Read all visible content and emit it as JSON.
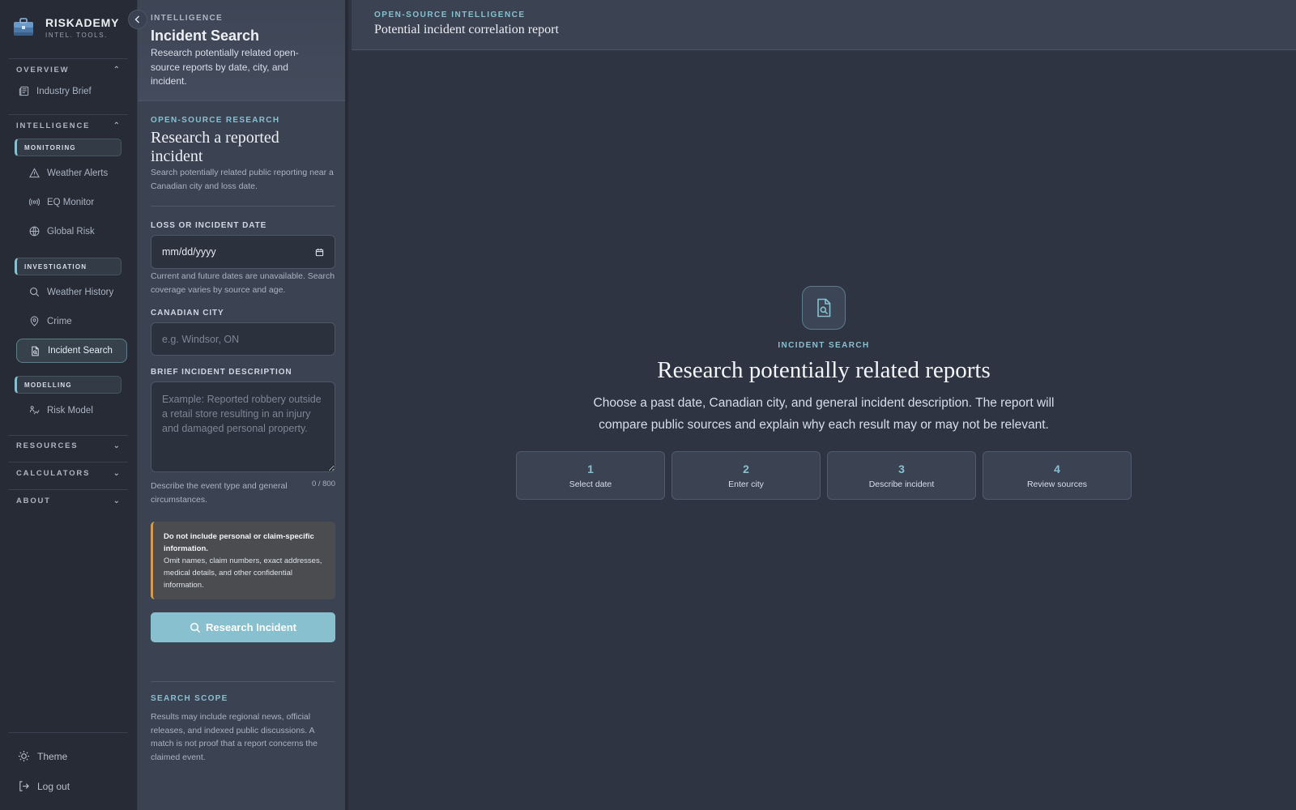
{
  "brand": {
    "name": "RISKADEMY",
    "tagline": "INTEL. TOOLS."
  },
  "sidebar": {
    "overview": {
      "label": "OVERVIEW",
      "chevron": "⌃",
      "items": [
        {
          "label": "Industry Brief",
          "icon": "newspaper-icon"
        }
      ]
    },
    "intelligence": {
      "label": "INTELLIGENCE",
      "chevron": "⌃",
      "monitoring": {
        "label": "MONITORING",
        "items": [
          {
            "label": "Weather Alerts",
            "icon": "warning-triangle-icon"
          },
          {
            "label": "EQ Monitor",
            "icon": "radar-icon"
          },
          {
            "label": "Global Risk",
            "icon": "globe-icon"
          }
        ]
      },
      "investigation": {
        "label": "INVESTIGATION",
        "items": [
          {
            "label": "Weather History",
            "icon": "search-icon"
          },
          {
            "label": "Crime",
            "icon": "map-pin-icon"
          },
          {
            "label": "Incident Search",
            "icon": "file-search-icon",
            "active": true
          }
        ]
      },
      "modelling": {
        "label": "MODELLING",
        "items": [
          {
            "label": "Risk Model",
            "icon": "chart-person-icon"
          }
        ]
      }
    },
    "resources": {
      "label": "RESOURCES",
      "chevron": "⌄"
    },
    "calculators": {
      "label": "CALCULATORS",
      "chevron": "⌄"
    },
    "about": {
      "label": "ABOUT",
      "chevron": "⌄"
    },
    "footer": {
      "theme": "Theme",
      "logout": "Log out"
    }
  },
  "panel": {
    "eyebrow": "INTELLIGENCE",
    "title": "Incident Search",
    "description": "Research potentially related open-source reports by date, city, and incident.",
    "form": {
      "eyebrow": "OPEN-SOURCE RESEARCH",
      "title": "Research a reported incident",
      "subtitle": "Search potentially related public reporting near a Canadian city and loss date.",
      "date": {
        "label": "LOSS OR INCIDENT DATE",
        "placeholder": "mm/dd/yyyy",
        "hint": "Current and future dates are unavailable. Search coverage varies by source and age."
      },
      "city": {
        "label": "CANADIAN CITY",
        "placeholder": "e.g. Windsor, ON",
        "value": ""
      },
      "description": {
        "label": "BRIEF INCIDENT DESCRIPTION",
        "placeholder": "Example: Reported robbery outside a retail store resulting in an injury and damaged personal property.",
        "hint": "Describe the event type and general circumstances.",
        "counter": "0 / 800"
      },
      "warning": {
        "title": "Do not include personal or claim-specific information.",
        "body": "Omit names, claim numbers, exact addresses, medical details, and other confidential information.",
        "color": "#d69a4c"
      },
      "submit": "Research Incident"
    },
    "scope": {
      "title": "SEARCH SCOPE",
      "body": "Results may include regional news, official releases, and indexed public discussions. A match is not proof that a report concerns the claimed event."
    }
  },
  "main": {
    "header": {
      "eyebrow": "OPEN-SOURCE INTELLIGENCE",
      "title": "Potential incident correlation report"
    },
    "empty": {
      "icon": "file-search-icon",
      "eyebrow": "INCIDENT SEARCH",
      "title": "Research potentially related reports",
      "description": "Choose a past date, Canadian city, and general incident description. The report will compare public sources and explain why each result may or may not be relevant.",
      "steps": [
        {
          "num": "1",
          "label": "Select date"
        },
        {
          "num": "2",
          "label": "Enter city"
        },
        {
          "num": "3",
          "label": "Describe incident"
        },
        {
          "num": "4",
          "label": "Review sources"
        }
      ]
    }
  },
  "colors": {
    "accent": "#88c0d0",
    "warning": "#d69a4c",
    "sidebar": "#262b36",
    "panel": "#3b4252",
    "main": "#2e3442"
  }
}
